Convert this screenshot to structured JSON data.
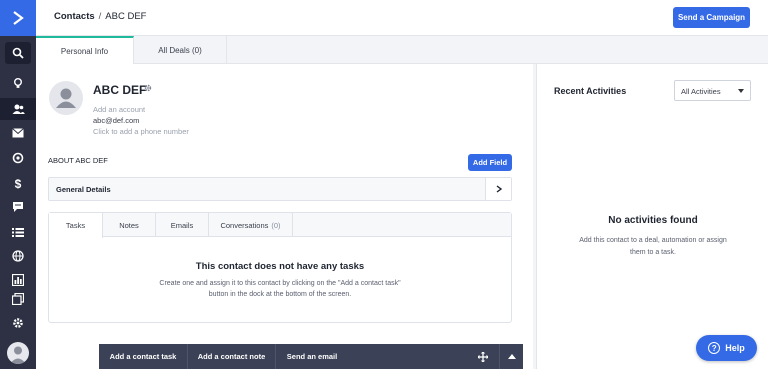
{
  "colors": {
    "accent": "#356ae6",
    "sidebar": "#2d3143",
    "active_tab": "#1fb99c",
    "dock": "#3b4156"
  },
  "sidebar": {
    "items": [
      {
        "icon": "search-icon"
      },
      {
        "icon": "lightbulb-icon"
      },
      {
        "icon": "contacts-icon"
      },
      {
        "icon": "mail-icon"
      },
      {
        "icon": "automation-icon"
      },
      {
        "icon": "dollar-icon"
      },
      {
        "icon": "chat-icon"
      },
      {
        "icon": "list-icon"
      },
      {
        "icon": "globe-icon"
      },
      {
        "icon": "reports-icon"
      },
      {
        "icon": "pages-icon"
      },
      {
        "icon": "gear-icon"
      }
    ]
  },
  "header": {
    "breadcrumb_root": "Contacts",
    "breadcrumb_sep": "/",
    "breadcrumb_current": "ABC DEF",
    "send_campaign": "Send a Campaign"
  },
  "tabs": [
    {
      "label": "Personal Info"
    },
    {
      "label": "All Deals (0)"
    }
  ],
  "contact": {
    "name": "ABC DEF",
    "add_account": "Add an account",
    "email": "abc@def.com",
    "phone_placeholder": "Click to add a phone number",
    "about": "ABOUT ABC DEF",
    "add_field": "Add Field",
    "general_details": "General Details"
  },
  "subtabs": {
    "tasks": "Tasks",
    "notes": "Notes",
    "emails": "Emails",
    "conversations": "Conversations",
    "conversations_count": "(0)"
  },
  "tasks_empty": {
    "title": "This contact does not have any tasks",
    "description": "Create one and assign it to this contact by clicking on the \"Add a contact task\" button in the dock at the bottom of the screen."
  },
  "dock": {
    "add_task": "Add a contact task",
    "add_note": "Add a contact note",
    "send_email": "Send an email"
  },
  "activities": {
    "title": "Recent Activities",
    "filter_value": "All Activities",
    "empty_title": "No activities found",
    "empty_description": "Add this contact to a deal, automation or assign them to a task."
  },
  "help": {
    "label": "Help"
  }
}
